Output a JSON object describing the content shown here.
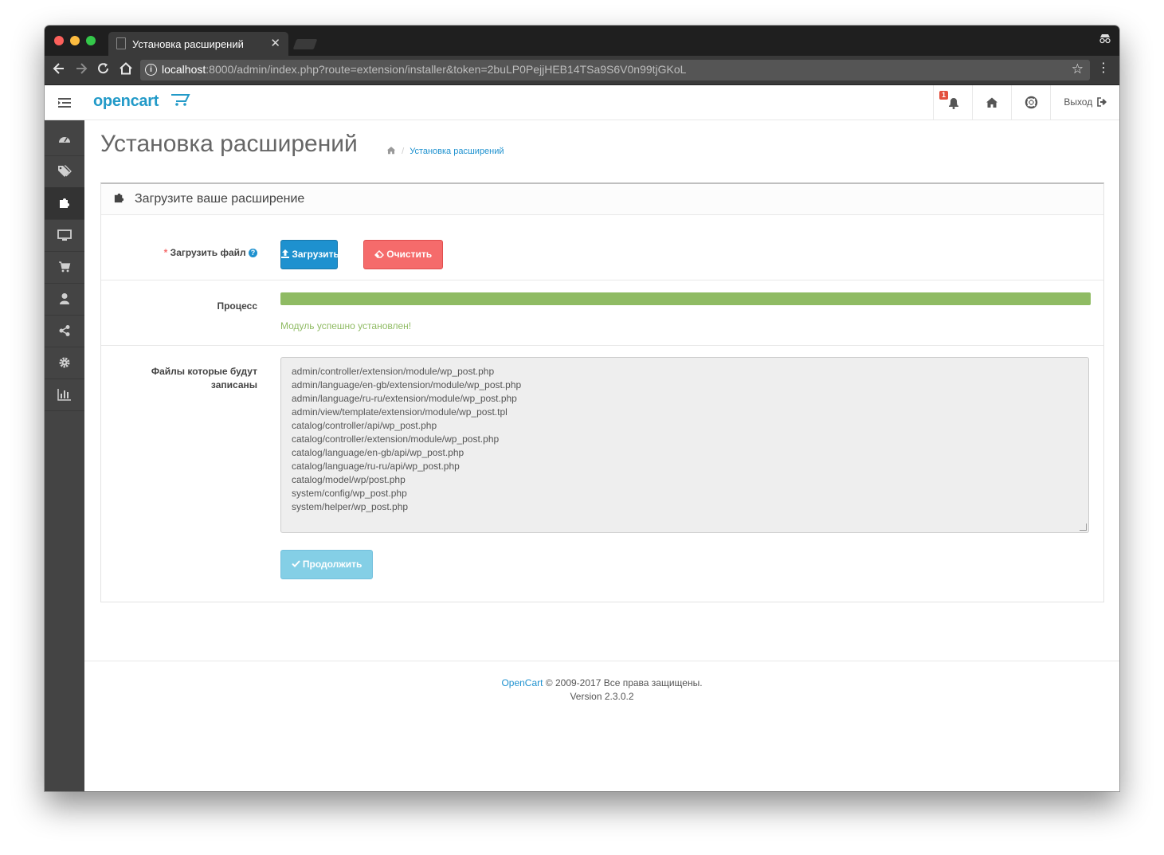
{
  "browser": {
    "tab_title": "Установка расширений",
    "url_host": "localhost",
    "url_rest": ":8000/admin/index.php?route=extension/installer&token=2buLP0PejjHEB14TSa9S6V0n99tjGKoL"
  },
  "header": {
    "logo": "opencart",
    "notifications_count": "1",
    "logout_label": "Выход"
  },
  "page": {
    "title": "Установка расширений",
    "breadcrumb": "Установка расширений"
  },
  "panel": {
    "title": "Загрузите ваше расширение",
    "upload_label_star": "*",
    "upload_label": "Загрузить файл",
    "upload_button": "Загрузить",
    "clear_button": "Очистить",
    "progress_label": "Процесс",
    "progress_percent": 100,
    "success_text": "Модуль успешно установлен!",
    "files_label": "Файлы которые будут записаны",
    "files": [
      "admin/controller/extension/module/wp_post.php",
      "admin/language/en-gb/extension/module/wp_post.php",
      "admin/language/ru-ru/extension/module/wp_post.php",
      "admin/view/template/extension/module/wp_post.tpl",
      "catalog/controller/api/wp_post.php",
      "catalog/controller/extension/module/wp_post.php",
      "catalog/language/en-gb/api/wp_post.php",
      "catalog/language/ru-ru/api/wp_post.php",
      "catalog/model/wp/post.php",
      "system/config/wp_post.php",
      "system/helper/wp_post.php"
    ],
    "continue_button": "Продолжить"
  },
  "footer": {
    "brand": "OpenCart",
    "copyright": " © 2009-2017 Все права защищены.",
    "version": "Version 2.3.0.2"
  },
  "colors": {
    "primary": "#1e91cf",
    "danger": "#f56b6b",
    "success": "#8fbb63",
    "sidebar": "#444444"
  },
  "sidebar_icons": [
    "dashboard-icon",
    "tags-icon",
    "puzzle-icon",
    "desktop-icon",
    "cart-icon",
    "user-icon",
    "share-icon",
    "cog-icon",
    "chart-icon"
  ]
}
